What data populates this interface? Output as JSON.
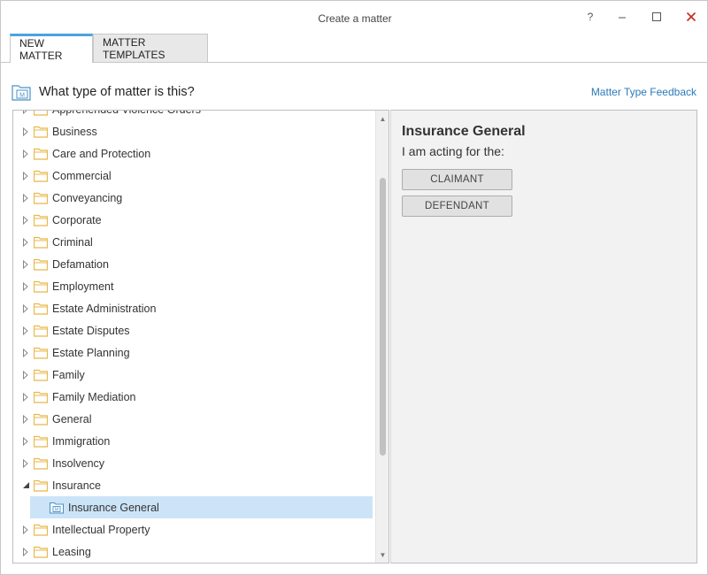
{
  "window": {
    "title": "Create a matter",
    "help": "?",
    "minimize": "–",
    "maximize": "☐",
    "close": "✕"
  },
  "tabs": [
    {
      "label": "NEW MATTER",
      "active": true
    },
    {
      "label": "MATTER TEMPLATES",
      "active": false
    }
  ],
  "question": "What type of matter is this?",
  "feedback_link": "Matter Type Feedback",
  "tree": {
    "items": [
      {
        "label": "Apprehended Violence Orders",
        "expanded": false
      },
      {
        "label": "Business",
        "expanded": false
      },
      {
        "label": "Care and Protection",
        "expanded": false
      },
      {
        "label": "Commercial",
        "expanded": false
      },
      {
        "label": "Conveyancing",
        "expanded": false
      },
      {
        "label": "Corporate",
        "expanded": false
      },
      {
        "label": "Criminal",
        "expanded": false
      },
      {
        "label": "Defamation",
        "expanded": false
      },
      {
        "label": "Employment",
        "expanded": false
      },
      {
        "label": "Estate Administration",
        "expanded": false
      },
      {
        "label": "Estate Disputes",
        "expanded": false
      },
      {
        "label": "Estate Planning",
        "expanded": false
      },
      {
        "label": "Family",
        "expanded": false
      },
      {
        "label": "Family Mediation",
        "expanded": false
      },
      {
        "label": "General",
        "expanded": false
      },
      {
        "label": "Immigration",
        "expanded": false
      },
      {
        "label": "Insolvency",
        "expanded": false
      },
      {
        "label": "Insurance",
        "expanded": true
      },
      {
        "label": "Insurance General",
        "child": true,
        "selected": true
      },
      {
        "label": "Intellectual Property",
        "expanded": false
      },
      {
        "label": "Leasing",
        "expanded": false
      }
    ]
  },
  "detail": {
    "title": "Insurance General",
    "subtitle": "I am acting for the:",
    "buttons": [
      "CLAIMANT",
      "DEFENDANT"
    ]
  },
  "colors": {
    "accent": "#4aa3df",
    "link": "#2a7ab8",
    "selection": "#cce4f7",
    "folder": "#e8b84a",
    "close": "#c42b1c"
  },
  "icons": {
    "folder": "folder-icon",
    "matter": "matter-type-icon",
    "expand": "chevron-right-icon",
    "expanded": "chevron-expanded-icon"
  }
}
